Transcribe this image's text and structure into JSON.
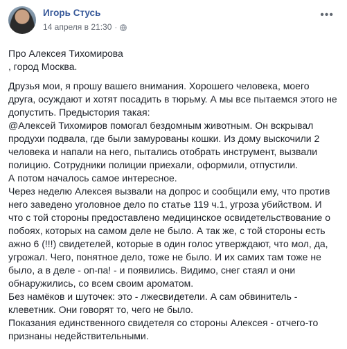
{
  "post": {
    "author": "Игорь Стусь",
    "timestamp": "14 апреля в 21:30",
    "separator": "·",
    "heading_lines": [
      "Про Алексея Тихомирова",
      ", город Москва."
    ],
    "body_lines": [
      "Друзья мои, я прошу вашего внимания. Хорошего человека, моего",
      "друга, осуждают и хотят посадить в тюрьму. А мы все пытаемся этого не",
      "допустить. Предыстория такая:",
      "@Алексей Тихомиров помогал бездомным животным. Он вскрывал",
      "продухи подвала, где были замурованы кошки. Из дому выскочили 2",
      "человека и напали на него, пытались отобрать инструмент, вызвали",
      "полицию. Сотрудники полиции приехали, оформили, отпустили.",
      "А потом началось самое интересное.",
      "Через неделю Алексея вызвали на допрос и сообщили ему, что против",
      "него заведено уголовное дело по статье 119 ч.1, угроза убийством. И",
      "что с той стороны предоставлено медицинское освидетельствование о",
      "побоях, которых на самом деле не было. А так же, с той стороны есть",
      "ажно 6 (!!!) свидетелей, которые в один голос утверждают, что мол, да,",
      "угрожал. Чего, понятное дело, тоже не было. И их самих там тоже не",
      "было, а в деле - оп-па! - и появились. Видимо, снег стаял и они",
      "обнаружились, со всем своим ароматом.",
      "Без намёков и шуточек: это - лжесвидетели. А сам обвинитель -",
      "клеветник. Они говорят то, чего не было.",
      "Показания единственного свидетеля со стороны Алексея - отчего-то",
      "признаны недействительными."
    ]
  },
  "icons": {
    "privacy": "globe-icon",
    "options": "more-options-icon"
  },
  "colors": {
    "author_link": "#365899",
    "text": "#1d2129",
    "meta": "#616770"
  }
}
